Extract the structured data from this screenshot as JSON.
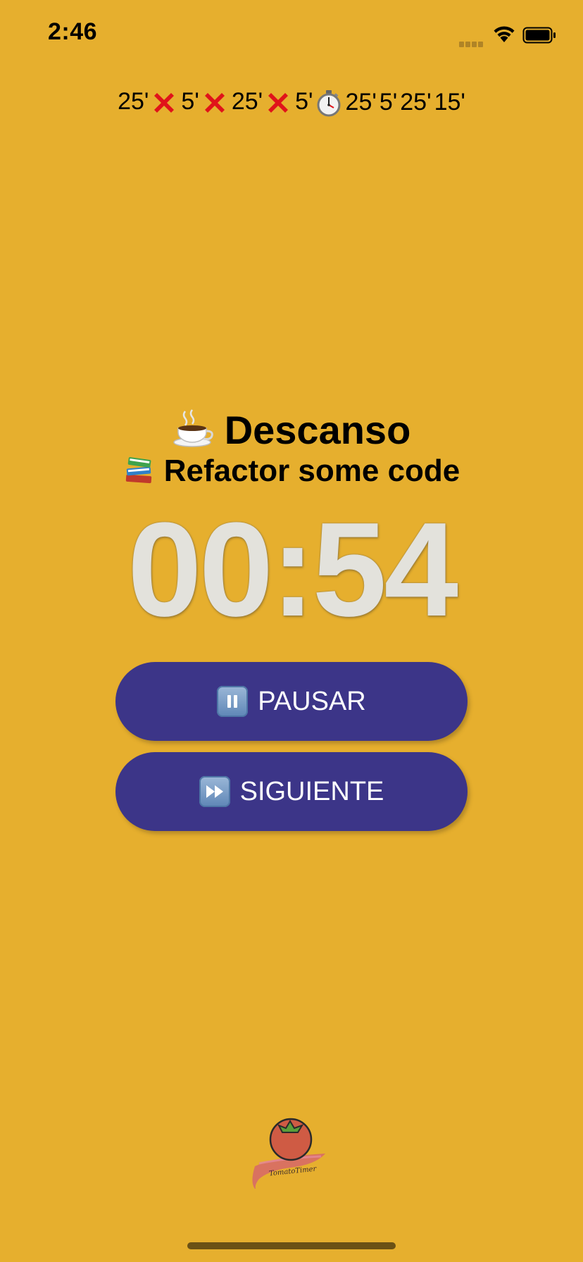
{
  "status_bar": {
    "time": "2:46"
  },
  "session_track": [
    {
      "label": "25'",
      "mark": "cancelled"
    },
    {
      "label": "5'",
      "mark": "cancelled"
    },
    {
      "label": "25'",
      "mark": "cancelled"
    },
    {
      "label": "5'",
      "mark": "current"
    },
    {
      "label": "25'",
      "mark": "none"
    },
    {
      "label": "5'",
      "mark": "none"
    },
    {
      "label": "25'",
      "mark": "none"
    },
    {
      "label": "15'",
      "mark": "none"
    }
  ],
  "session": {
    "icon": "coffee-icon",
    "title": "Descanso"
  },
  "task": {
    "icon": "books-icon",
    "title": "Refactor some code"
  },
  "timer": {
    "value": "00:54"
  },
  "buttons": {
    "pause_label": "PAUSAR",
    "pause_icon": "pause-icon",
    "next_label": "SIGUIENTE",
    "next_icon": "fast-forward-icon"
  },
  "logo": {
    "text": "TomatoTimer"
  },
  "colors": {
    "background": "#E6AF2E",
    "button": "#3C3588",
    "timer_text": "#E3E2DC",
    "cancel_mark": "#E0131A"
  }
}
